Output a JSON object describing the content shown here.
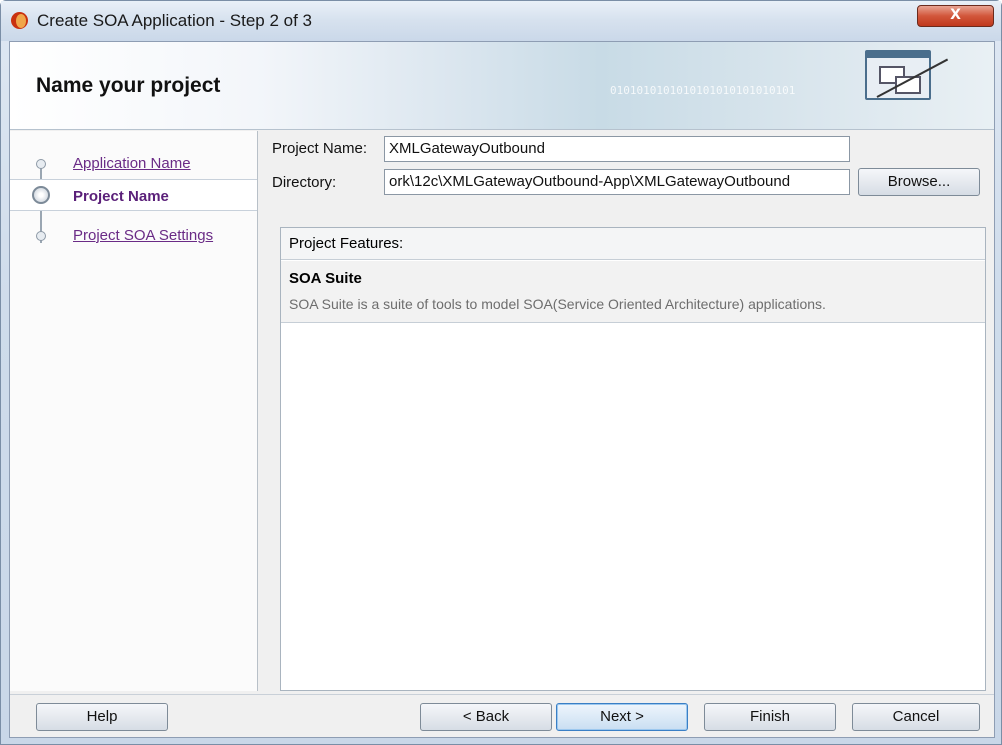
{
  "window": {
    "title": "Create SOA Application - Step 2 of 3",
    "close_label": "X"
  },
  "banner": {
    "title": "Name your project",
    "binary_text": "0101010101010101010101010101"
  },
  "steps": [
    {
      "label": "Application Name",
      "state": "link"
    },
    {
      "label": "Project Name",
      "state": "current"
    },
    {
      "label": "Project SOA Settings",
      "state": "link"
    }
  ],
  "form": {
    "project_name_label": "Project Name:",
    "project_name_value": "XMLGatewayOutbound",
    "directory_label": "Directory:",
    "directory_value": "ork\\12c\\XMLGatewayOutbound-App\\XMLGatewayOutbound",
    "browse_label": "Browse..."
  },
  "features": {
    "header": "Project Features:",
    "items": [
      {
        "title": "SOA Suite",
        "description": "SOA Suite is a suite of tools to model SOA(Service Oriented Architecture) applications."
      }
    ]
  },
  "buttons": {
    "help": "Help",
    "back": "< Back",
    "next": "Next >",
    "finish": "Finish",
    "cancel": "Cancel"
  },
  "icons": [
    "app-icon",
    "close-icon",
    "wizard-banner-icon",
    "step-indicator-icon"
  ],
  "colors": {
    "link": "#6a2b86",
    "current_step": "#5a1f79",
    "close_button": "#c0381c",
    "default_button_border": "#3a7fc5"
  }
}
